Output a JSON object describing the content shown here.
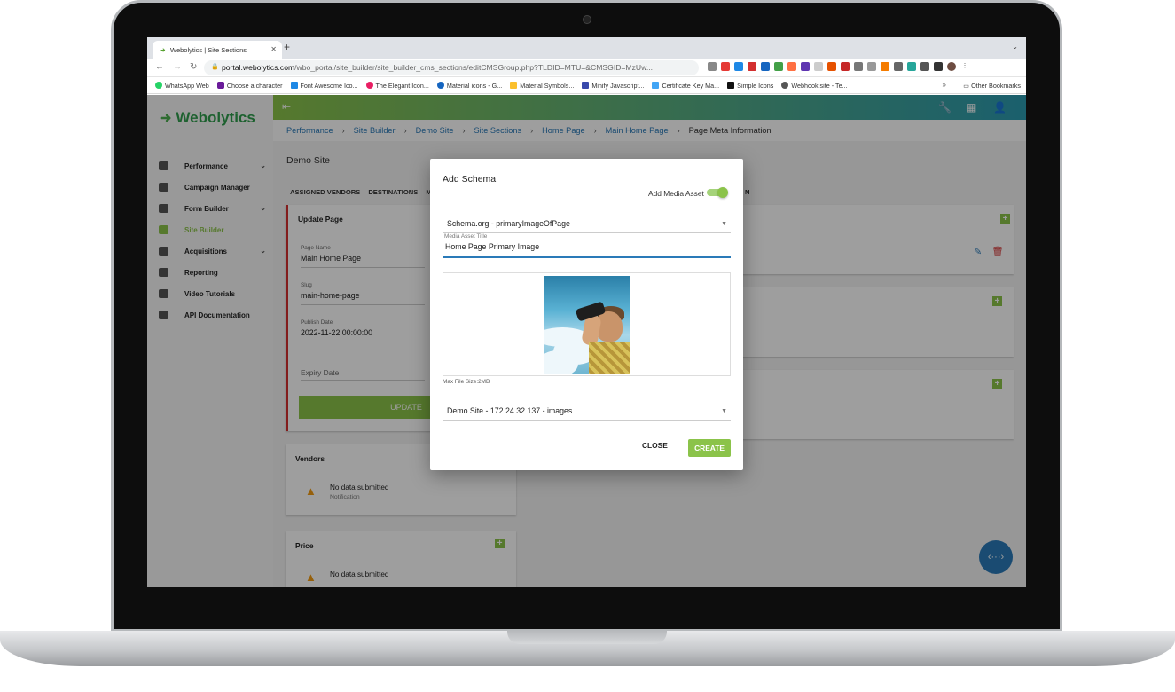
{
  "browser": {
    "tab_title": "Webolytics | Site Sections",
    "url_host": "portal.webolytics.com",
    "url_path": "/wbo_portal/site_builder/site_builder_cms_sections/editCMSGroup.php?TLDID=MTU=&CMSGID=MzUw...",
    "bookmarks": [
      "WhatsApp Web",
      "Choose a character",
      "Font Awesome Ico...",
      "The Elegant Icon...",
      "Material icons - G...",
      "Material Symbols...",
      "Minify Javascript...",
      "Certificate Key Ma...",
      "Simple Icons",
      "Webhook.site - Te..."
    ],
    "bookmarks_more": "»",
    "other_bookmarks": "Other Bookmarks"
  },
  "app": {
    "brand": "Webolytics",
    "nav": [
      {
        "label": "Performance"
      },
      {
        "label": "Campaign Manager"
      },
      {
        "label": "Form Builder"
      },
      {
        "label": "Site Builder"
      },
      {
        "label": "Acquisitions"
      },
      {
        "label": "Reporting"
      },
      {
        "label": "Video Tutorials"
      },
      {
        "label": "API Documentation"
      }
    ],
    "breadcrumbs": [
      "Performance",
      "Site Builder",
      "Demo Site",
      "Site Sections",
      "Home Page",
      "Main Home Page",
      "Page Meta Information"
    ],
    "site_title": "Demo Site",
    "subtabs": [
      "ASSIGNED VENDORS",
      "DESTINATIONS",
      "ME",
      "N"
    ],
    "update_card": {
      "title": "Update Page",
      "page_name_label": "Page Name",
      "page_name_value": "Main Home Page",
      "slug_label": "Slug",
      "slug_value": "main-home-page",
      "publish_label": "Publish Date",
      "publish_value": "2022-11-22 00:00:00",
      "expiry_label": "Expiry Date",
      "button": "UPDATE"
    },
    "vendors_card": {
      "title": "Vendors",
      "nodata": "No data submitted",
      "sub": "Notification"
    },
    "price_card": {
      "title": "Price",
      "nodata": "No data submitted"
    },
    "fab_label": "‹···›"
  },
  "modal": {
    "title": "Add Schema",
    "toggle_label": "Add Media Asset",
    "toggle_on": true,
    "schema_select": "Schema.org - primaryImageOfPage",
    "title_field_label": "Media Asset Title",
    "title_field_value": "Home Page Primary Image",
    "max_size": "Max File Size:2MB",
    "folder_select": "Demo Site - 172.24.32.137 - images",
    "close_label": "CLOSE",
    "create_label": "CREATE"
  },
  "colors": {
    "accent_green": "#8bc34a",
    "link_blue": "#2a7ab8",
    "topbar_gradient_end": "#2c9bb0"
  }
}
